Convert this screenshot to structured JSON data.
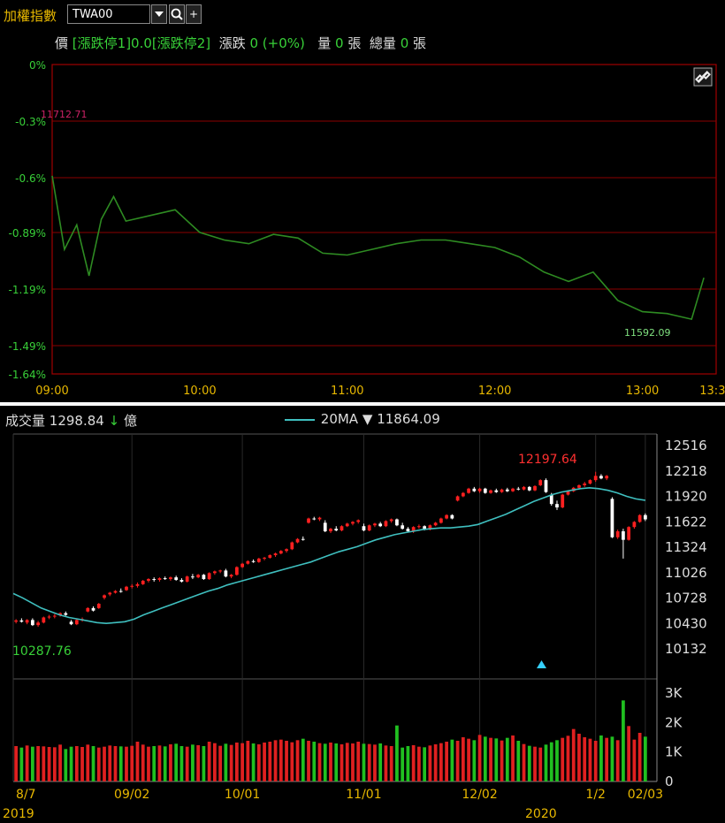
{
  "header": {
    "title": "加權指數",
    "symbol": "TWA00",
    "dropdown_icon": "caret-down-icon",
    "search_icon": "magnifier-icon",
    "add_icon": "plus-icon",
    "add_label": "+"
  },
  "quote": {
    "price_label": "價",
    "price_value": "[漲跌停1]0.0[漲跌停2]",
    "change_label": "漲跌",
    "change_value": "0 (+0%)",
    "volume_label": "量",
    "volume_value": "0",
    "volume_unit": "張",
    "total_volume_label": "總量",
    "total_volume_value": "0",
    "total_volume_unit": "張"
  },
  "intraday": {
    "link_icon": "link-icon",
    "y_ticks": [
      "0%",
      "-0.3%",
      "-0.6%",
      "-0.89%",
      "-1.19%",
      "-1.49%",
      "-1.64%"
    ],
    "x_ticks": [
      "09:00",
      "10:00",
      "11:00",
      "12:00",
      "13:00",
      "13:30"
    ],
    "high_label": "11712.71",
    "low_label": "11592.09",
    "line_color": "#2e8b22",
    "grid_color": "#8b0000"
  },
  "daily": {
    "volume_title": "成交量",
    "volume_value": "1298.84",
    "volume_arrow": "↓",
    "volume_unit": "億",
    "ma_label": "20MA",
    "ma_arrow": "▼",
    "ma_value": "11864.09",
    "high_label": "12197.64",
    "low_label": "10287.76",
    "price_ticks": [
      "12516",
      "12218",
      "11920",
      "11622",
      "11324",
      "11026",
      "10728",
      "10430",
      "10132"
    ],
    "volume_ticks": [
      "3K",
      "2K",
      "1K",
      "0"
    ],
    "date_ticks": [
      "8/7",
      "09/02",
      "10/01",
      "11/01",
      "12/02",
      "1/2",
      "02/03"
    ],
    "year_labels": [
      "2019",
      "2020"
    ],
    "up_color": "#ff2020",
    "down_color": "#ffffff",
    "ma_color": "#3fbfbf"
  },
  "chart_data": [
    {
      "type": "line",
      "x": [
        "09:00",
        "09:05",
        "09:10",
        "09:15",
        "09:20",
        "09:25",
        "09:30",
        "09:40",
        "09:50",
        "10:00",
        "10:10",
        "10:20",
        "10:30",
        "10:40",
        "10:50",
        "11:00",
        "11:10",
        "11:20",
        "11:30",
        "11:40",
        "11:50",
        "12:00",
        "12:10",
        "12:20",
        "12:30",
        "12:40",
        "12:50",
        "13:00",
        "13:10",
        "13:20",
        "13:25"
      ],
      "y": [
        -0.59,
        -0.98,
        -0.85,
        -1.12,
        -0.82,
        -0.7,
        -0.83,
        -0.8,
        -0.77,
        -0.89,
        -0.93,
        -0.95,
        -0.9,
        -0.92,
        -1.0,
        -1.01,
        -0.98,
        -0.95,
        -0.93,
        -0.93,
        -0.95,
        -0.97,
        -1.02,
        -1.1,
        -1.15,
        -1.1,
        -1.25,
        -1.31,
        -1.32,
        -1.35,
        -1.13
      ],
      "ylim": [
        -1.64,
        0
      ],
      "xlim": [
        "09:00",
        "13:30"
      ],
      "grid": true
    },
    {
      "type": "candlestick",
      "candles": [
        [
          10440,
          10470,
          10420,
          10455
        ],
        [
          10455,
          10480,
          10430,
          10440
        ],
        [
          10430,
          10470,
          10410,
          10460
        ],
        [
          10460,
          10480,
          10390,
          10400
        ],
        [
          10400,
          10450,
          10380,
          10430
        ],
        [
          10430,
          10500,
          10420,
          10490
        ],
        [
          10490,
          10520,
          10470,
          10500
        ],
        [
          10500,
          10530,
          10480,
          10510
        ],
        [
          10520,
          10550,
          10500,
          10540
        ],
        [
          10540,
          10560,
          10510,
          10520
        ],
        [
          10440,
          10460,
          10400,
          10410
        ],
        [
          10410,
          10470,
          10400,
          10460
        ],
        [
          10460,
          10490,
          10440,
          10470
        ],
        [
          10560,
          10610,
          10550,
          10600
        ],
        [
          10600,
          10620,
          10560,
          10570
        ],
        [
          10600,
          10660,
          10590,
          10650
        ],
        [
          10720,
          10760,
          10700,
          10750
        ],
        [
          10760,
          10790,
          10740,
          10780
        ],
        [
          10780,
          10810,
          10770,
          10800
        ],
        [
          10800,
          10830,
          10780,
          10790
        ],
        [
          10810,
          10860,
          10800,
          10850
        ],
        [
          10850,
          10880,
          10830,
          10860
        ],
        [
          10860,
          10900,
          10840,
          10880
        ],
        [
          10880,
          10930,
          10870,
          10920
        ],
        [
          10920,
          10950,
          10900,
          10940
        ],
        [
          10940,
          10960,
          10910,
          10930
        ],
        [
          10930,
          10960,
          10910,
          10950
        ],
        [
          10950,
          10970,
          10930,
          10940
        ],
        [
          10940,
          10970,
          10920,
          10960
        ],
        [
          10960,
          10980,
          10920,
          10930
        ],
        [
          10930,
          10950,
          10900,
          10910
        ],
        [
          10910,
          10980,
          10900,
          10970
        ],
        [
          10970,
          11000,
          10940,
          10960
        ],
        [
          10960,
          11000,
          10950,
          10990
        ],
        [
          10990,
          11000,
          10930,
          10940
        ],
        [
          10940,
          11020,
          10930,
          11010
        ],
        [
          11010,
          11040,
          10990,
          11030
        ],
        [
          11030,
          11050,
          11010,
          11040
        ],
        [
          11040,
          11060,
          10960,
          10970
        ],
        [
          10970,
          11000,
          10950,
          10990
        ],
        [
          10990,
          11090,
          10980,
          11080
        ],
        [
          11080,
          11130,
          11070,
          11120
        ],
        [
          11120,
          11160,
          11110,
          11150
        ],
        [
          11150,
          11170,
          11130,
          11140
        ],
        [
          11140,
          11190,
          11130,
          11180
        ],
        [
          11180,
          11200,
          11160,
          11190
        ],
        [
          11190,
          11230,
          11180,
          11220
        ],
        [
          11220,
          11250,
          11200,
          11240
        ],
        [
          11240,
          11280,
          11230,
          11270
        ],
        [
          11270,
          11300,
          11250,
          11290
        ],
        [
          11290,
          11380,
          11280,
          11370
        ],
        [
          11370,
          11420,
          11360,
          11410
        ],
        [
          11410,
          11440,
          11390,
          11400
        ],
        [
          11600,
          11660,
          11590,
          11650
        ],
        [
          11650,
          11670,
          11630,
          11640
        ],
        [
          11640,
          11670,
          11620,
          11660
        ],
        [
          11600,
          11630,
          11490,
          11500
        ],
        [
          11500,
          11540,
          11480,
          11530
        ],
        [
          11530,
          11560,
          11500,
          11510
        ],
        [
          11510,
          11570,
          11500,
          11560
        ],
        [
          11560,
          11600,
          11550,
          11590
        ],
        [
          11590,
          11620,
          11570,
          11610
        ],
        [
          11610,
          11640,
          11590,
          11630
        ],
        [
          11560,
          11590,
          11500,
          11510
        ],
        [
          11510,
          11580,
          11500,
          11570
        ],
        [
          11570,
          11600,
          11550,
          11590
        ],
        [
          11590,
          11610,
          11550,
          11560
        ],
        [
          11560,
          11630,
          11550,
          11620
        ],
        [
          11620,
          11650,
          11600,
          11640
        ],
        [
          11640,
          11650,
          11560,
          11570
        ],
        [
          11570,
          11600,
          11520,
          11530
        ],
        [
          11530,
          11550,
          11490,
          11500
        ],
        [
          11500,
          11560,
          11480,
          11550
        ],
        [
          11550,
          11580,
          11530,
          11560
        ],
        [
          11560,
          11570,
          11510,
          11520
        ],
        [
          11520,
          11580,
          11510,
          11570
        ],
        [
          11570,
          11610,
          11560,
          11600
        ],
        [
          11600,
          11660,
          11590,
          11650
        ],
        [
          11650,
          11700,
          11640,
          11690
        ],
        [
          11690,
          11700,
          11640,
          11650
        ],
        [
          11860,
          11920,
          11850,
          11910
        ],
        [
          11910,
          11960,
          11900,
          11950
        ],
        [
          11950,
          12010,
          11940,
          12000
        ],
        [
          12000,
          12020,
          11960,
          11970
        ],
        [
          11970,
          12010,
          11950,
          12000
        ],
        [
          12000,
          12010,
          11940,
          11950
        ],
        [
          11950,
          11990,
          11940,
          11980
        ],
        [
          11980,
          12000,
          11950,
          11960
        ],
        [
          11960,
          12000,
          11950,
          11990
        ],
        [
          11990,
          12010,
          11960,
          11970
        ],
        [
          11970,
          12010,
          11960,
          12000
        ],
        [
          12000,
          12020,
          11980,
          11990
        ],
        [
          11990,
          12030,
          11980,
          12020
        ],
        [
          12020,
          12030,
          11970,
          11980
        ],
        [
          11980,
          12040,
          11970,
          12030
        ],
        [
          12040,
          12110,
          12030,
          12100
        ],
        [
          12100,
          12120,
          11950,
          11960
        ],
        [
          11930,
          11950,
          11800,
          11820
        ],
        [
          11820,
          11860,
          11750,
          11780
        ],
        [
          11780,
          11940,
          11770,
          11930
        ],
        [
          11930,
          11980,
          11920,
          11970
        ],
        [
          11970,
          12020,
          11960,
          12010
        ],
        [
          12010,
          12050,
          11990,
          12040
        ],
        [
          12040,
          12080,
          12020,
          12060
        ],
        [
          12060,
          12110,
          12050,
          12100
        ],
        [
          12100,
          12198,
          12080,
          12150
        ],
        [
          12150,
          12170,
          12110,
          12120
        ],
        [
          12120,
          12160,
          12100,
          12150
        ],
        [
          11880,
          11900,
          11420,
          11430
        ],
        [
          11430,
          11520,
          11410,
          11500
        ],
        [
          11500,
          11530,
          11180,
          11400
        ],
        [
          11400,
          11560,
          11390,
          11550
        ],
        [
          11550,
          11620,
          11530,
          11610
        ],
        [
          11610,
          11700,
          11600,
          11690
        ],
        [
          11690,
          11710,
          11620,
          11640
        ]
      ],
      "ma20": [
        10770,
        10720,
        10660,
        10600,
        10560,
        10520,
        10490,
        10470,
        10450,
        10430,
        10420,
        10430,
        10440,
        10470,
        10520,
        10560,
        10600,
        10640,
        10680,
        10720,
        10760,
        10800,
        10830,
        10870,
        10900,
        10930,
        10960,
        10990,
        11020,
        11050,
        11080,
        11110,
        11140,
        11180,
        11220,
        11260,
        11290,
        11320,
        11360,
        11400,
        11430,
        11460,
        11480,
        11500,
        11520,
        11530,
        11540,
        11540,
        11550,
        11560,
        11580,
        11620,
        11660,
        11700,
        11750,
        11800,
        11850,
        11890,
        11930,
        11960,
        11980,
        12000,
        12010,
        12000,
        11980,
        11950,
        11910,
        11880,
        11864
      ],
      "volume": [
        1200,
        1150,
        1220,
        1180,
        1200,
        1190,
        1170,
        1160,
        1250,
        1100,
        1180,
        1200,
        1170,
        1250,
        1200,
        1150,
        1180,
        1220,
        1200,
        1190,
        1180,
        1210,
        1350,
        1250,
        1180,
        1200,
        1220,
        1190,
        1260,
        1280,
        1200,
        1180,
        1250,
        1230,
        1200,
        1350,
        1300,
        1210,
        1280,
        1240,
        1320,
        1300,
        1380,
        1290,
        1260,
        1320,
        1350,
        1400,
        1420,
        1380,
        1330,
        1400,
        1450,
        1380,
        1350,
        1300,
        1280,
        1320,
        1290,
        1260,
        1310,
        1290,
        1350,
        1280,
        1270,
        1250,
        1290,
        1220,
        1200,
        1900,
        1150,
        1200,
        1230,
        1180,
        1160,
        1220,
        1260,
        1300,
        1350,
        1420,
        1380,
        1500,
        1450,
        1400,
        1580,
        1520,
        1480,
        1460,
        1390,
        1480,
        1560,
        1380,
        1270,
        1210,
        1180,
        1150,
        1250,
        1330,
        1400,
        1480,
        1550,
        1780,
        1620,
        1500,
        1450,
        1380,
        1560,
        1480,
        1520,
        1400,
        2750,
        1880,
        1420,
        1650,
        1520,
        1400,
        1300
      ],
      "ylim": [
        10132,
        12516
      ],
      "volume_ylim": [
        0,
        3000
      ],
      "date_ticks": [
        "8/7",
        "09/02",
        "10/01",
        "11/01",
        "12/02",
        "1/2",
        "02/03"
      ],
      "high": 12197.64,
      "low": 10287.76
    }
  ]
}
